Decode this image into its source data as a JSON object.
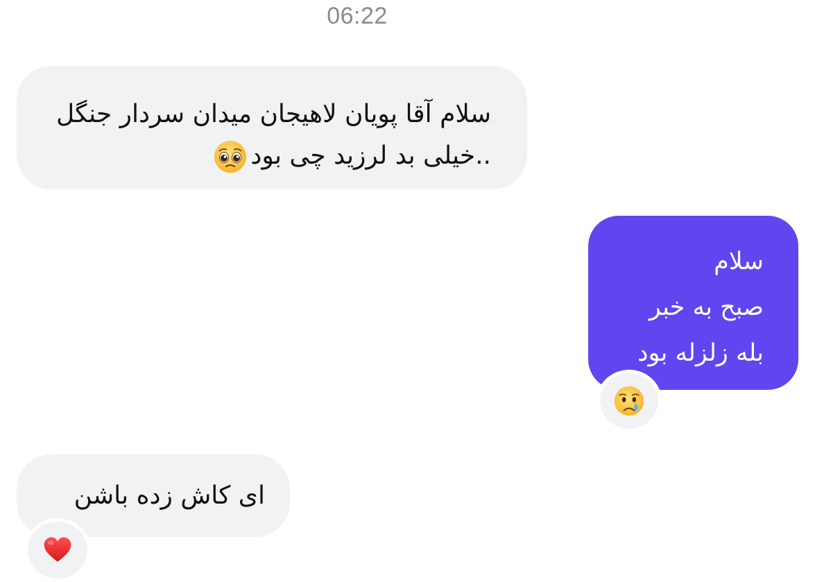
{
  "chat": {
    "timestamp": "06:22",
    "messages": [
      {
        "direction": "incoming",
        "text": "سلام آقا پویان لاهیجان میدان سردار جنگل ..خیلی بد لرزید چی بود",
        "inline_emoji": "pleading-face-emoji"
      },
      {
        "direction": "outgoing",
        "text": "سلام\nصبح به خبر\nبله زلزله بود",
        "reaction": "crying-face-emoji"
      },
      {
        "direction": "incoming",
        "text": "ای کاش زده باشن",
        "reaction": "red-heart-emoji"
      }
    ]
  },
  "colors": {
    "incoming_bubble": "#f1f2f4",
    "outgoing_bubble": "#6046ef",
    "timestamp_text": "#8a8a8e"
  }
}
